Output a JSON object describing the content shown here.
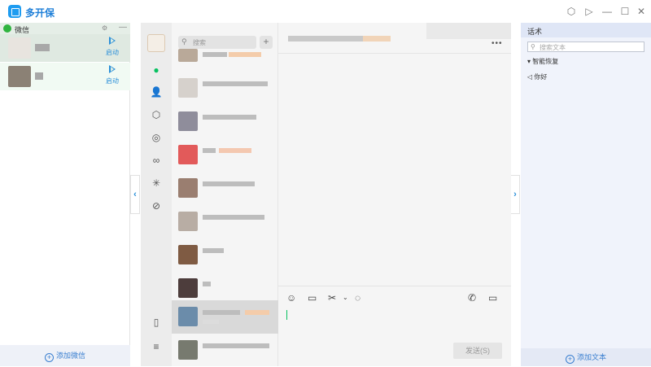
{
  "app": {
    "title": "多开保"
  },
  "left": {
    "account_title": "微信",
    "accounts": [
      {
        "start_label": "启动",
        "avatar_color": "#e8e4df"
      },
      {
        "start_label": "启动",
        "avatar_color": "#8b8175"
      }
    ],
    "add_label": "添加微信"
  },
  "chat": {
    "search_placeholder": "搜索",
    "send_label": "发送(S)"
  },
  "right": {
    "title": "话术",
    "search_placeholder": "搜索文本",
    "category": "智能恢复",
    "item": "你好",
    "add_label": "添加文本"
  },
  "colors": {
    "accent": "#2a8fd8",
    "wechat_green": "#2fb43f"
  }
}
